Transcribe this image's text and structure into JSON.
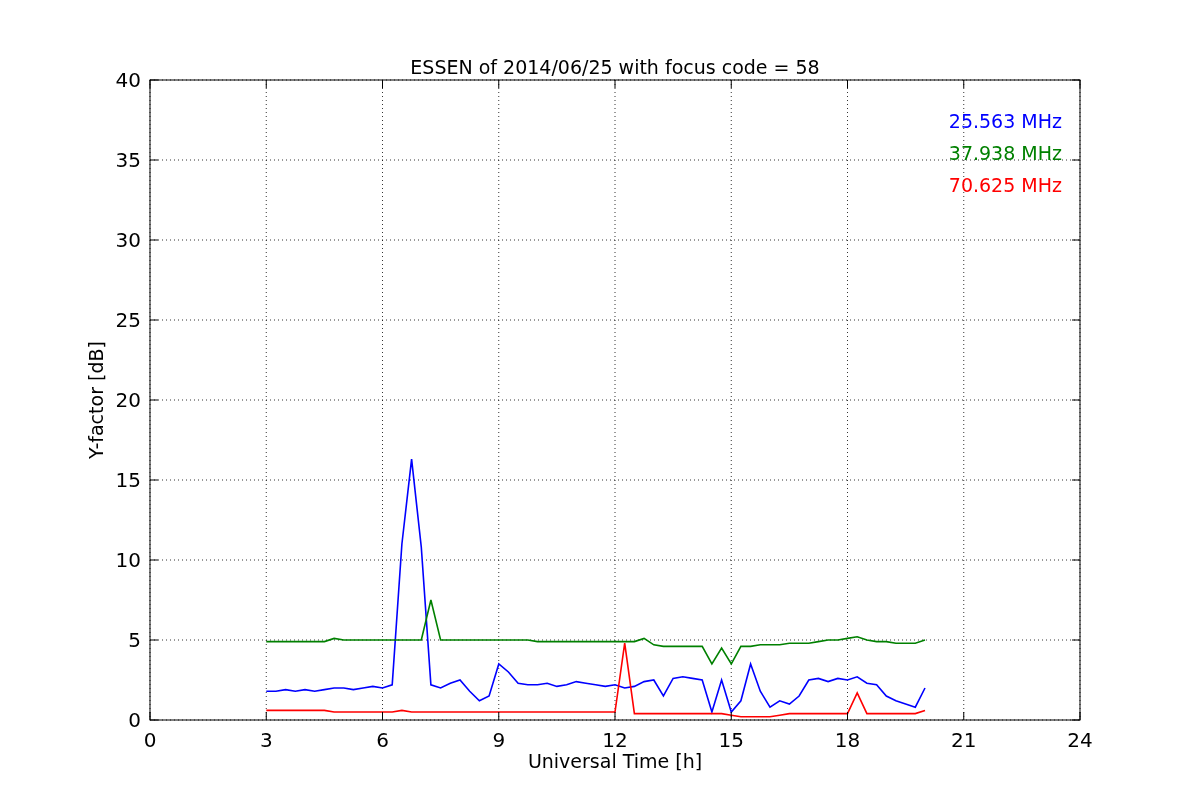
{
  "figure": {
    "chart_data": {
      "type": "line",
      "title": "ESSEN of 2014/06/25 with focus code = 58",
      "xlabel": "Universal Time [h]",
      "ylabel": "Y-factor [dB]",
      "x": [
        3,
        3.25,
        3.5,
        3.75,
        4,
        4.25,
        4.5,
        4.75,
        5,
        5.25,
        5.5,
        5.75,
        6,
        6.25,
        6.5,
        6.75,
        7,
        7.25,
        7.5,
        7.75,
        8,
        8.25,
        8.5,
        8.75,
        9,
        9.25,
        9.5,
        9.75,
        10,
        10.25,
        10.5,
        10.75,
        11,
        11.25,
        11.5,
        11.75,
        12,
        12.25,
        12.5,
        12.75,
        13,
        13.25,
        13.5,
        13.75,
        14,
        14.25,
        14.5,
        14.75,
        15,
        15.25,
        15.5,
        15.75,
        16,
        16.25,
        16.5,
        16.75,
        17,
        17.25,
        17.5,
        17.75,
        18,
        18.25,
        18.5,
        18.75,
        19,
        19.25,
        19.5,
        19.75,
        20
      ],
      "series": [
        {
          "name": "25.563 MHz",
          "color": "#0000ff",
          "values": [
            1.8,
            1.8,
            1.9,
            1.8,
            1.9,
            1.8,
            1.9,
            2.0,
            2.0,
            1.9,
            2.0,
            2.1,
            2.0,
            2.2,
            11.0,
            16.3,
            10.8,
            2.2,
            2.0,
            2.3,
            2.5,
            1.8,
            1.2,
            1.5,
            3.5,
            3.0,
            2.3,
            2.2,
            2.2,
            2.3,
            2.1,
            2.2,
            2.4,
            2.3,
            2.2,
            2.1,
            2.2,
            2.0,
            2.1,
            2.4,
            2.5,
            1.5,
            2.6,
            2.7,
            2.6,
            2.5,
            0.5,
            2.5,
            0.5,
            1.2,
            3.5,
            1.8,
            0.8,
            1.2,
            1.0,
            1.5,
            2.5,
            2.6,
            2.4,
            2.6,
            2.5,
            2.7,
            2.3,
            2.2,
            1.5,
            1.2,
            1.0,
            0.8,
            2.0
          ]
        },
        {
          "name": "37.938 MHz",
          "color": "#008000",
          "values": [
            4.9,
            4.9,
            4.9,
            4.9,
            4.9,
            4.9,
            4.9,
            5.1,
            5.0,
            5.0,
            5.0,
            5.0,
            5.0,
            5.0,
            5.0,
            5.0,
            5.0,
            7.5,
            5.0,
            5.0,
            5.0,
            5.0,
            5.0,
            5.0,
            5.0,
            5.0,
            5.0,
            5.0,
            4.9,
            4.9,
            4.9,
            4.9,
            4.9,
            4.9,
            4.9,
            4.9,
            4.9,
            4.9,
            4.9,
            5.1,
            4.7,
            4.6,
            4.6,
            4.6,
            4.6,
            4.6,
            3.5,
            4.5,
            3.5,
            4.6,
            4.6,
            4.7,
            4.7,
            4.7,
            4.8,
            4.8,
            4.8,
            4.9,
            5.0,
            5.0,
            5.1,
            5.2,
            5.0,
            4.9,
            4.9,
            4.8,
            4.8,
            4.8,
            5.0
          ]
        },
        {
          "name": "70.625 MHz",
          "color": "#ff0000",
          "values": [
            0.6,
            0.6,
            0.6,
            0.6,
            0.6,
            0.6,
            0.6,
            0.5,
            0.5,
            0.5,
            0.5,
            0.5,
            0.5,
            0.5,
            0.6,
            0.5,
            0.5,
            0.5,
            0.5,
            0.5,
            0.5,
            0.5,
            0.5,
            0.5,
            0.5,
            0.5,
            0.5,
            0.5,
            0.5,
            0.5,
            0.5,
            0.5,
            0.5,
            0.5,
            0.5,
            0.5,
            0.5,
            4.8,
            0.4,
            0.4,
            0.4,
            0.4,
            0.4,
            0.4,
            0.4,
            0.4,
            0.4,
            0.4,
            0.3,
            0.2,
            0.2,
            0.2,
            0.2,
            0.3,
            0.4,
            0.4,
            0.4,
            0.4,
            0.4,
            0.4,
            0.4,
            1.7,
            0.4,
            0.4,
            0.4,
            0.4,
            0.4,
            0.4,
            0.6
          ]
        }
      ],
      "xlim": [
        0,
        24
      ],
      "ylim": [
        0,
        40
      ],
      "xticks": [
        0,
        3,
        6,
        9,
        12,
        15,
        18,
        21,
        24
      ],
      "yticks": [
        0,
        5,
        10,
        15,
        20,
        25,
        30,
        35,
        40
      ],
      "grid": true
    }
  }
}
